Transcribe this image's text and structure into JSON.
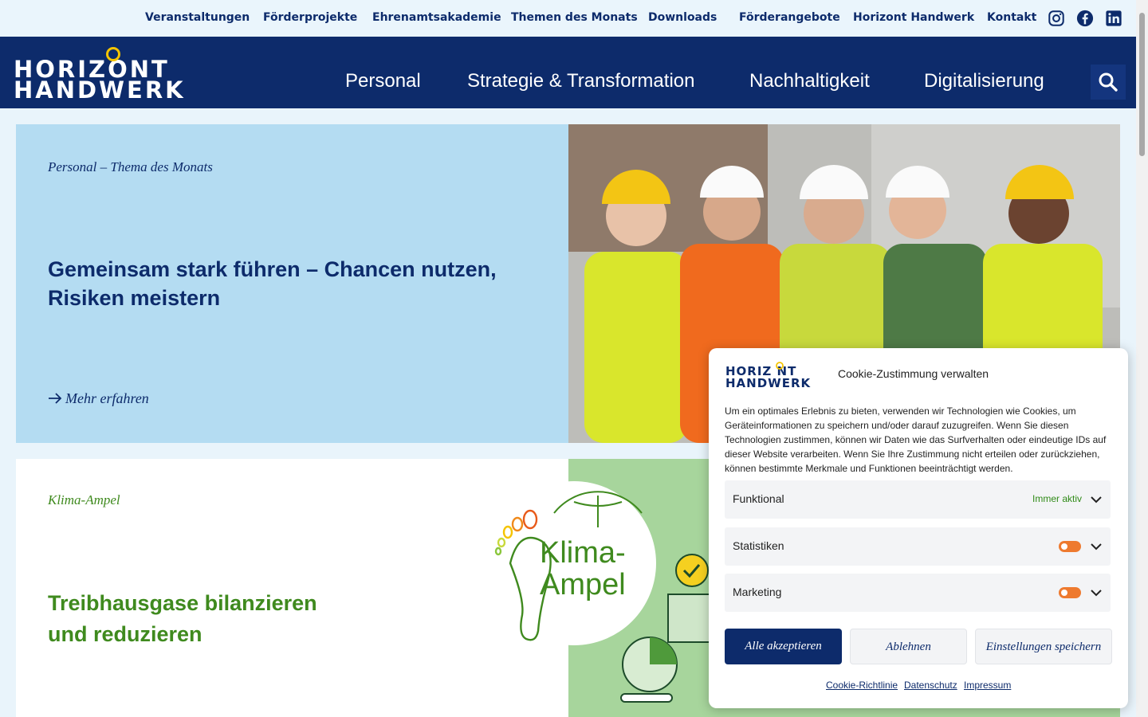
{
  "topbar": {
    "links": [
      "Veranstaltungen",
      "Förderprojekte",
      "Ehrenamtsakademie",
      "Themen des Monats",
      "Downloads",
      "Förderangebote",
      "Horizont Handwerk",
      "Kontakt"
    ],
    "social": [
      "instagram-icon",
      "facebook-icon",
      "linkedin-icon"
    ]
  },
  "nav": {
    "logo_line1": "HORIZONT",
    "logo_line2": "HANDWERK",
    "items": [
      "Personal",
      "Strategie & Transformation",
      "Nachhaltigkeit",
      "Digitalisierung"
    ],
    "search_icon": "search-icon"
  },
  "hero": {
    "kicker": "Personal – Thema des Monats",
    "title": "Gemeinsam stark führen – Chancen nutzen, Risiken meistern",
    "cta": "Mehr erfahren"
  },
  "klima": {
    "kicker": "Klima-Ampel",
    "title": "Treibhausgase bilanzieren und reduzieren",
    "badge_line1": "Klima-",
    "badge_line2": "Ampel"
  },
  "cookie": {
    "logo_line1": "HORIZ NT",
    "logo_line2": "HANDWERK",
    "title": "Cookie-Zustimmung verwalten",
    "text": "Um ein optimales Erlebnis zu bieten, verwenden wir Technologien wie Cookies, um Geräteinformationen zu speichern und/oder darauf zuzugreifen. Wenn Sie diesen Technologien zustimmen, können wir Daten wie das Surfverhalten oder eindeutige IDs auf dieser Website verarbeiten. Wenn Sie Ihre Zustimmung nicht erteilen oder zurückziehen, können bestimmte Merkmale und Funktionen beeinträchtigt werden.",
    "rows": [
      {
        "label": "Funktional",
        "status": "Immer aktiv"
      },
      {
        "label": "Statistiken"
      },
      {
        "label": "Marketing"
      }
    ],
    "buttons": {
      "accept": "Alle akzeptieren",
      "deny": "Ablehnen",
      "save": "Einstellungen speichern"
    },
    "links": [
      "Cookie-Richtlinie",
      "Datenschutz",
      "Impressum"
    ]
  },
  "colors": {
    "navy": "#0d2b6b",
    "sky": "#b4dcf2",
    "green": "#3f8a1e",
    "orange": "#ee7a2f",
    "yellow": "#f5c400"
  }
}
